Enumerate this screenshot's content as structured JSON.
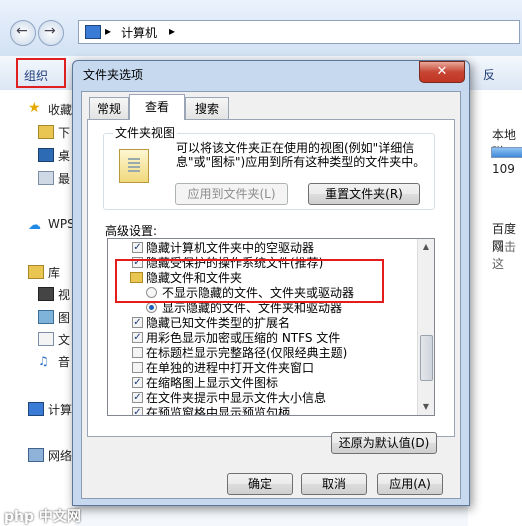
{
  "explorer": {
    "address": [
      "计算机"
    ],
    "organize_label": "组织",
    "right_cmd_label": "反",
    "sidebar": [
      {
        "label": "收藏",
        "icon": "star-icon"
      },
      {
        "label": "下",
        "icon": "folder-icon"
      },
      {
        "label": "桌",
        "icon": "desktop-icon"
      },
      {
        "label": "最",
        "icon": "recent-icon"
      },
      {
        "label": "WPS",
        "icon": "cloud-icon"
      },
      {
        "label": "库",
        "icon": "library-icon"
      },
      {
        "label": "视",
        "icon": "video-icon"
      },
      {
        "label": "图",
        "icon": "picture-icon"
      },
      {
        "label": "文",
        "icon": "document-icon"
      },
      {
        "label": "音",
        "icon": "music-icon"
      },
      {
        "label": "计算",
        "icon": "computer-icon"
      },
      {
        "label": "网络",
        "icon": "network-icon"
      }
    ],
    "right_pane": {
      "drive_label": "本地磁",
      "drive_size": "109",
      "app_label": "百度网",
      "app_sub": "双击这"
    }
  },
  "dialog": {
    "title": "文件夹选项",
    "close": "✕",
    "tabs": [
      "常规",
      "查看",
      "搜索"
    ],
    "active_tab": 1,
    "folder_view": {
      "legend": "文件夹视图",
      "description": "可以将该文件夹正在使用的视图(例如\"详细信息\"或\"图标\")应用到所有这种类型的文件夹中。",
      "apply_button": "应用到文件夹(L)",
      "reset_button": "重置文件夹(R)"
    },
    "advanced_label": "高级设置:",
    "settings": [
      {
        "type": "checkbox",
        "checked": true,
        "label": "隐藏计算机文件夹中的空驱动器"
      },
      {
        "type": "checkbox",
        "checked": true,
        "label": "隐藏受保护的操作系统文件(推荐)"
      },
      {
        "type": "folder",
        "label": "隐藏文件和文件夹"
      },
      {
        "type": "radio",
        "checked": false,
        "label": "不显示隐藏的文件、文件夹或驱动器"
      },
      {
        "type": "radio",
        "checked": true,
        "label": "显示隐藏的文件、文件夹和驱动器"
      },
      {
        "type": "checkbox",
        "checked": true,
        "label": "隐藏已知文件类型的扩展名"
      },
      {
        "type": "checkbox",
        "checked": true,
        "label": "用彩色显示加密或压缩的 NTFS 文件"
      },
      {
        "type": "checkbox",
        "checked": false,
        "label": "在标题栏显示完整路径(仅限经典主题)"
      },
      {
        "type": "checkbox",
        "checked": false,
        "label": "在单独的进程中打开文件夹窗口"
      },
      {
        "type": "checkbox",
        "checked": true,
        "label": "在缩略图上显示文件图标"
      },
      {
        "type": "checkbox",
        "checked": true,
        "label": "在文件夹提示中显示文件大小信息"
      },
      {
        "type": "checkbox",
        "checked": true,
        "label": "在预览窗格中显示预览句柄"
      }
    ],
    "restore_button": "还原为默认值(D)",
    "ok_button": "确定",
    "cancel_button": "取消",
    "apply_button": "应用(A)"
  },
  "watermark": "php 中文网"
}
